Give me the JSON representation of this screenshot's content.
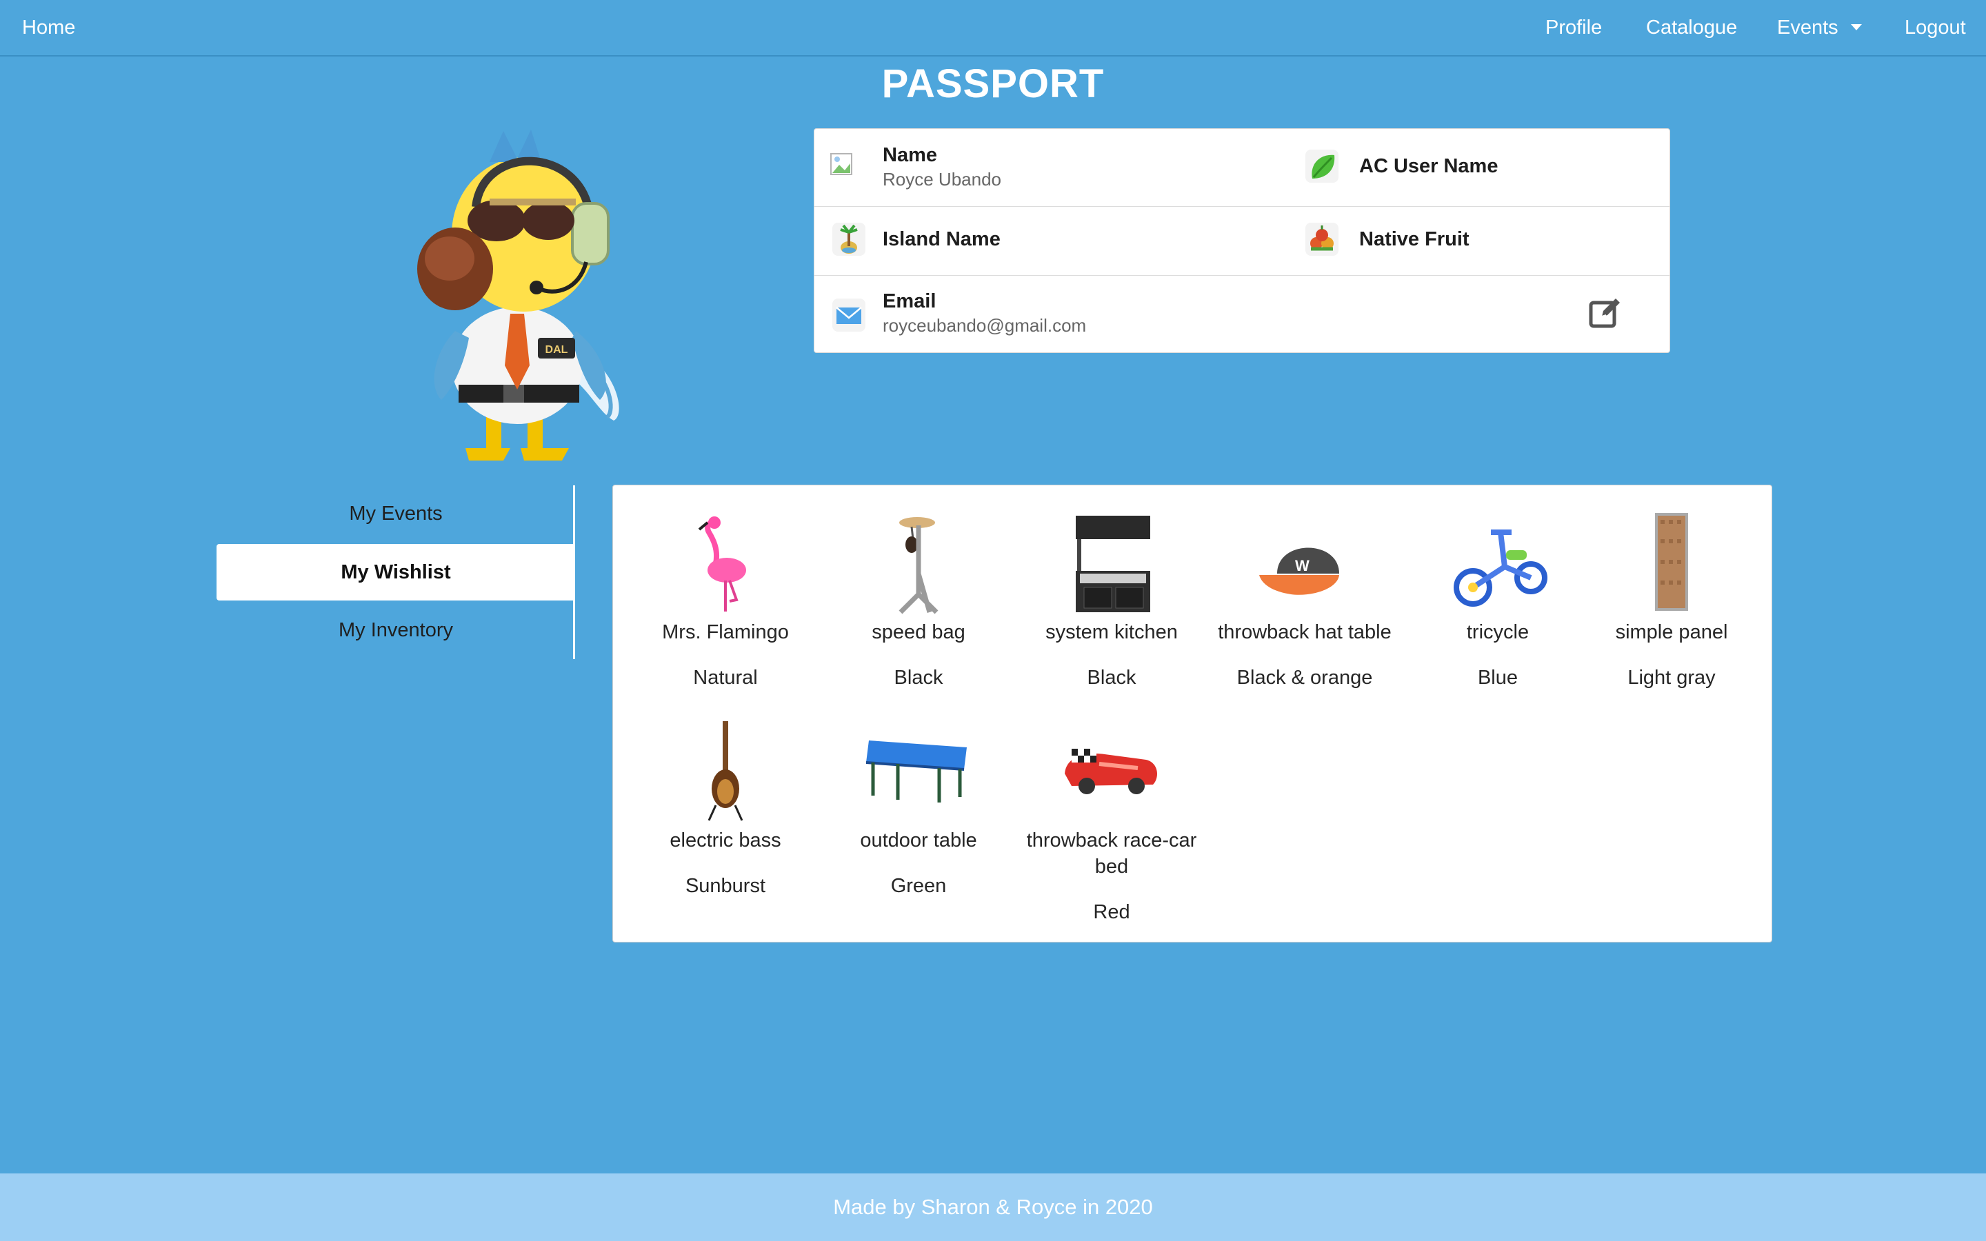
{
  "nav": {
    "home": "Home",
    "profile": "Profile",
    "catalogue": "Catalogue",
    "events": "Events",
    "logout": "Logout"
  },
  "page_title": "PASSPORT",
  "passport": {
    "name_label": "Name",
    "name_value": "Royce Ubando",
    "ac_user_label": "AC User Name",
    "island_label": "Island Name",
    "fruit_label": "Native Fruit",
    "email_label": "Email",
    "email_value": "royceubando@gmail.com"
  },
  "tabs": [
    {
      "label": "My Events",
      "active": false
    },
    {
      "label": "My Wishlist",
      "active": true
    },
    {
      "label": "My Inventory",
      "active": false
    }
  ],
  "wishlist": [
    {
      "name": "Mrs. Flamingo",
      "variant": "Natural",
      "icon": "flamingo-icon"
    },
    {
      "name": "speed bag",
      "variant": "Black",
      "icon": "speed-bag-icon"
    },
    {
      "name": "system kitchen",
      "variant": "Black",
      "icon": "kitchen-icon"
    },
    {
      "name": "throwback hat table",
      "variant": "Black & orange",
      "icon": "hat-table-icon"
    },
    {
      "name": "tricycle",
      "variant": "Blue",
      "icon": "tricycle-icon"
    },
    {
      "name": "simple panel",
      "variant": "Light gray",
      "icon": "panel-icon"
    },
    {
      "name": "electric bass",
      "variant": "Sunburst",
      "icon": "bass-guitar-icon"
    },
    {
      "name": "outdoor table",
      "variant": "Green",
      "icon": "table-icon"
    },
    {
      "name": "throwback race-car bed",
      "variant": "Red",
      "icon": "race-car-bed-icon"
    }
  ],
  "footer": "Made by Sharon & Royce in 2020",
  "colors": {
    "background": "#4ea6dc",
    "footer": "#9ccff4",
    "card": "#ffffff"
  }
}
